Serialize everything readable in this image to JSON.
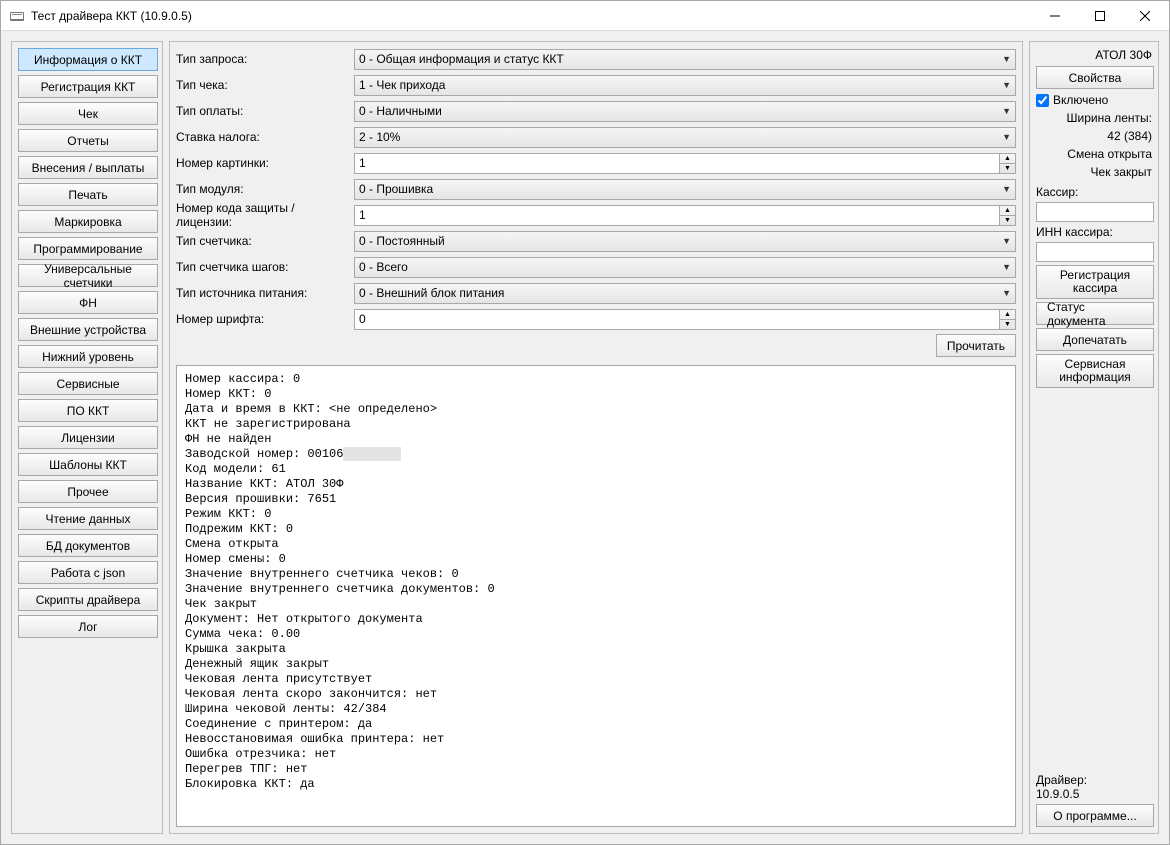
{
  "window": {
    "title": "Тест драйвера ККТ (10.9.0.5)"
  },
  "sidebar": {
    "items": [
      {
        "label": "Информация о ККТ",
        "active": true
      },
      {
        "label": "Регистрация ККТ"
      },
      {
        "label": "Чек"
      },
      {
        "label": "Отчеты"
      },
      {
        "label": "Внесения / выплаты"
      },
      {
        "label": "Печать"
      },
      {
        "label": "Маркировка"
      },
      {
        "label": "Программирование"
      },
      {
        "label": "Универсальные счетчики"
      },
      {
        "label": "ФН"
      },
      {
        "label": "Внешние устройства"
      },
      {
        "label": "Нижний уровень"
      },
      {
        "label": "Сервисные"
      },
      {
        "label": "ПО ККТ"
      },
      {
        "label": "Лицензии"
      },
      {
        "label": "Шаблоны ККТ"
      },
      {
        "label": "Прочее"
      },
      {
        "label": "Чтение данных"
      },
      {
        "label": "БД документов"
      },
      {
        "label": "Работа с json"
      },
      {
        "label": "Скрипты драйвера"
      },
      {
        "label": "Лог"
      }
    ]
  },
  "form": {
    "rows": [
      {
        "label": "Тип запроса:",
        "type": "select",
        "value": "0 - Общая информация и статус ККТ"
      },
      {
        "label": "Тип чека:",
        "type": "select",
        "value": "1 - Чек прихода"
      },
      {
        "label": "Тип оплаты:",
        "type": "select",
        "value": "0 - Наличными"
      },
      {
        "label": "Ставка налога:",
        "type": "select",
        "value": "2 - 10%"
      },
      {
        "label": "Номер картинки:",
        "type": "spinner",
        "value": "1"
      },
      {
        "label": "Тип модуля:",
        "type": "select",
        "value": "0 - Прошивка"
      },
      {
        "label": "Номер кода защиты / лицензии:",
        "type": "spinner",
        "value": "1"
      },
      {
        "label": "Тип счетчика:",
        "type": "select",
        "value": "0 - Постоянный"
      },
      {
        "label": "Тип счетчика шагов:",
        "type": "select",
        "value": "0 - Всего"
      },
      {
        "label": "Тип источника питания:",
        "type": "select",
        "value": "0 - Внешний блок питания"
      },
      {
        "label": "Номер шрифта:",
        "type": "spinner",
        "value": "0"
      }
    ],
    "read_button": "Прочитать"
  },
  "output": {
    "lines": [
      "Номер кассира: 0",
      "Номер ККТ: 0",
      "Дата и время в ККТ: <не определено>",
      "ККТ не зарегистрирована",
      "ФН не найден",
      "Заводской номер: 00106__________",
      "Код модели: 61",
      "Название ККТ: АТОЛ 30Ф",
      "Версия прошивки: 7651",
      "Режим ККТ: 0",
      "Подрежим ККТ: 0",
      "Смена открыта",
      "Номер смены: 0",
      "Значение внутреннего счетчика чеков: 0",
      "Значение внутреннего счетчика документов: 0",
      "Чек закрыт",
      "Документ: Нет открытого документа",
      "Сумма чека: 0.00",
      "Крышка закрыта",
      "Денежный ящик закрыт",
      "Чековая лента присутствует",
      "Чековая лента скоро закончится: нет",
      "Ширина чековой ленты: 42/384",
      "Соединение с принтером: да",
      "Невосстановимая ошибка принтера: нет",
      "Ошибка отрезчика: нет",
      "Перегрев ТПГ: нет",
      "Блокировка ККТ: да"
    ]
  },
  "right": {
    "model": "АТОЛ 30Ф",
    "properties_btn": "Свойства",
    "enabled_label": "Включено",
    "tape_width_label": "Ширина ленты:",
    "tape_width_value": "42 (384)",
    "shift_status": "Смена открыта",
    "check_status": "Чек закрыт",
    "cashier_label": "Кассир:",
    "cashier_value": "",
    "cashier_inn_label": "ИНН кассира:",
    "cashier_inn_value": "",
    "register_cashier_btn": "Регистрация кассира",
    "doc_status_btn": "Статус документа",
    "reprint_btn": "Допечатать",
    "service_info_btn": "Сервисная информация",
    "driver_label": "Драйвер:",
    "driver_version": "10.9.0.5",
    "about_btn": "О программе..."
  }
}
